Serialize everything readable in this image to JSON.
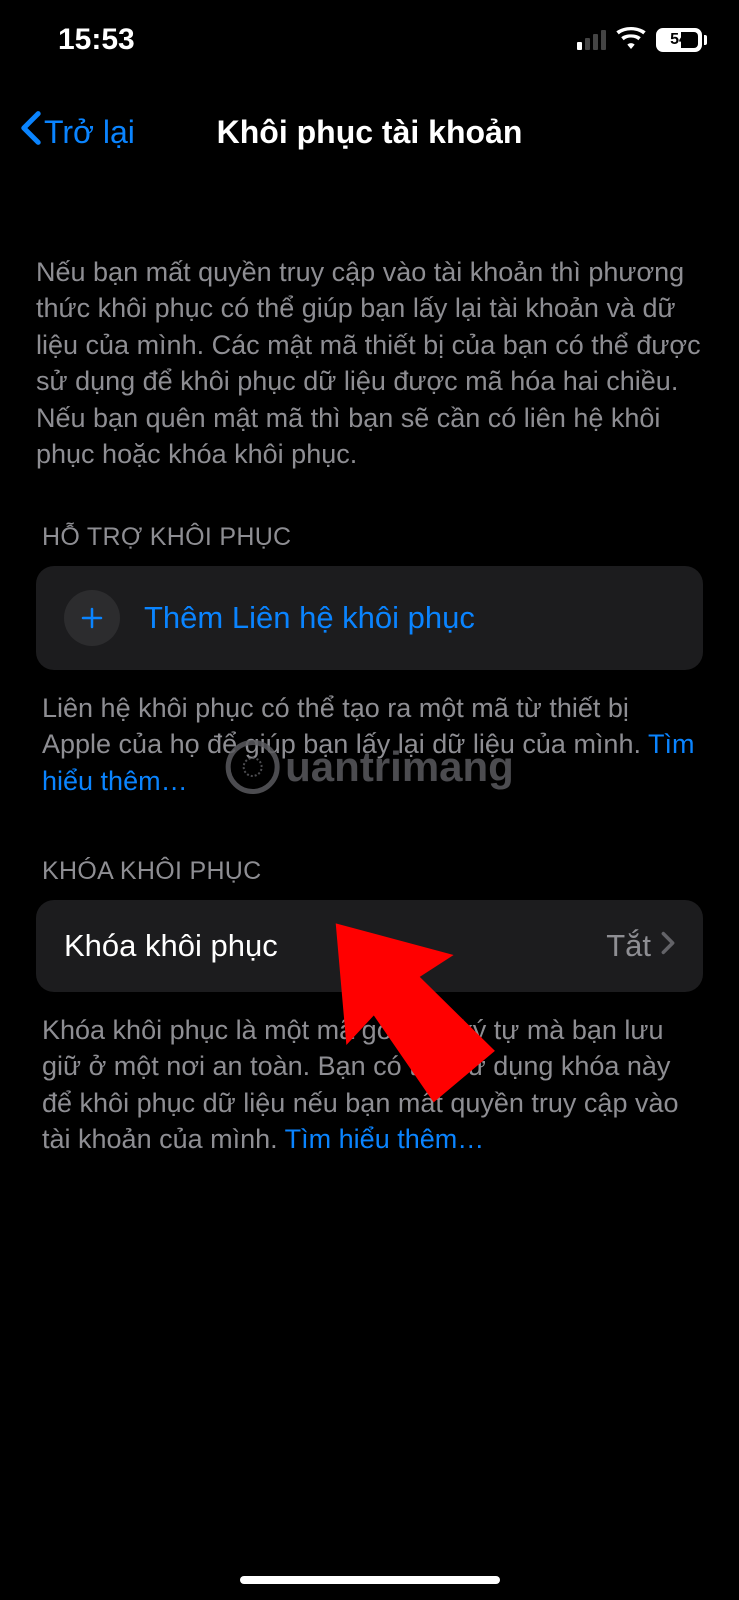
{
  "statusBar": {
    "time": "15:53",
    "batteryPercent": "54"
  },
  "nav": {
    "backLabel": "Trở lại",
    "title": "Khôi phục tài khoản"
  },
  "intro": "Nếu bạn mất quyền truy cập vào tài khoản thì phương thức khôi phục có thể giúp bạn lấy lại tài khoản và dữ liệu của mình. Các mật mã thiết bị của bạn có thể được sử dụng để khôi phục dữ liệu được mã hóa hai chiều. Nếu bạn quên mật mã thì bạn sẽ cần có liên hệ khôi phục hoặc khóa khôi phục.",
  "section1": {
    "header": "HỖ TRỢ KHÔI PHỤC",
    "addLabel": "Thêm Liên hệ khôi phục",
    "footer1": "Liên hệ khôi phục có thể tạo ra một mã từ thiết bị Apple của họ để giúp bạn lấy lại dữ liệu của mình. ",
    "learnMore": "Tìm hiểu thêm…"
  },
  "section2": {
    "header": "KHÓA KHÔI PHỤC",
    "rowLabel": "Khóa khôi phục",
    "rowStatus": "Tắt",
    "footer1": "Khóa khôi phục là một mã gồm 28 ký tự mà bạn lưu giữ ở một nơi an toàn. Bạn có thể sử dụng khóa này để khôi phục dữ liệu nếu bạn mất quyền truy cập vào tài khoản của mình. ",
    "learnMore": "Tìm hiểu thêm…"
  },
  "watermark": "uantrimang"
}
